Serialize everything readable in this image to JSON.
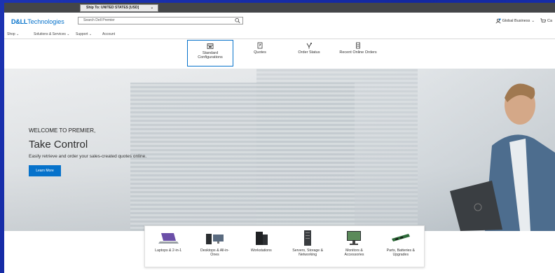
{
  "shipbar": {
    "label": "Ship To: UNITED STATES [USD]"
  },
  "logo": {
    "brand": "D&LL",
    "text": "Technologies"
  },
  "search": {
    "placeholder": "Search Dell Premier"
  },
  "topright": {
    "business": "Global Business",
    "cart": "Ca"
  },
  "nav": {
    "shop": "Shop",
    "solutions": "Solutions & Services",
    "support": "Support",
    "account": "Account"
  },
  "tiles": [
    {
      "label1": "Standard",
      "label2": "Configurations"
    },
    {
      "label1": "Quotes",
      "label2": ""
    },
    {
      "label1": "Order Status",
      "label2": ""
    },
    {
      "label1": "Recent Online Orders",
      "label2": ""
    }
  ],
  "hero": {
    "welcome": "WELCOME TO PREMIER,",
    "headline": "Take Control",
    "sub": "Easily retrieve and order your sales-created quotes online.",
    "button": "Learn More"
  },
  "categories": [
    {
      "label1": "Laptops & 2-in-1",
      "label2": ""
    },
    {
      "label1": "Desktops & All-in-",
      "label2": "Ones"
    },
    {
      "label1": "Workstations",
      "label2": ""
    },
    {
      "label1": "Servers, Storage &",
      "label2": "Networking"
    },
    {
      "label1": "Monitors &",
      "label2": "Accessories"
    },
    {
      "label1": "Parts, Batteries &",
      "label2": "Upgrades"
    }
  ],
  "colors": {
    "accent": "#0672cb",
    "shipbar": "#444648"
  }
}
